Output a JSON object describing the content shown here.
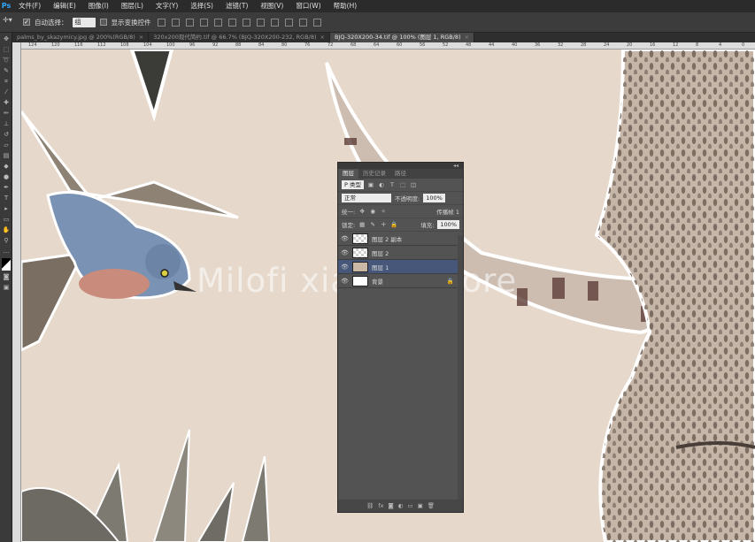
{
  "app": {
    "logo": "Ps"
  },
  "menu": [
    "文件(F)",
    "编辑(E)",
    "图像(I)",
    "图层(L)",
    "文字(Y)",
    "选择(S)",
    "滤镜(T)",
    "视图(V)",
    "窗口(W)",
    "帮助(H)"
  ],
  "options": {
    "tool_icon": "move-tool",
    "auto_select_label": "自动选择：",
    "auto_select_value": "组",
    "show_transform_label": "显示变换控件"
  },
  "tabs": [
    {
      "label": "palms_by_skazymicy.jpg @ 200%(RGB/8)",
      "close": "×",
      "active": false
    },
    {
      "label": "320x200现代简约.tif @ 66.7% (BJQ-320X200-232, RGB/8)",
      "close": "×",
      "active": false
    },
    {
      "label": "BJQ-320X200-34.tif @ 100% (图层 1, RGB/8)",
      "close": "×",
      "active": true
    }
  ],
  "ruler_ticks": [
    "124",
    "120",
    "116",
    "112",
    "108",
    "104",
    "100",
    "96",
    "92",
    "88",
    "84",
    "80",
    "76",
    "72",
    "68",
    "64",
    "60",
    "56",
    "52",
    "48",
    "44",
    "40",
    "36",
    "32",
    "28",
    "24",
    "20",
    "16",
    "12",
    "8",
    "4",
    "0"
  ],
  "watermark": "Milofi xiaoou Store",
  "layers_panel": {
    "collapse": "◂◂",
    "tabs": [
      "图层",
      "历史记录",
      "路径"
    ],
    "filter_label": "P 类型",
    "blend_mode": "正常",
    "opacity_label": "不透明度:",
    "opacity_value": "100%",
    "unify_label": "统一:",
    "propagate_label": "传播帧 1",
    "lock_label": "锁定:",
    "fill_label": "填充:",
    "fill_value": "100%",
    "layers": [
      {
        "name": "图层 2 副本",
        "visible": true,
        "thumb": "transparent",
        "selected": false
      },
      {
        "name": "图层 2",
        "visible": true,
        "thumb": "transparent",
        "selected": false
      },
      {
        "name": "图层 1",
        "visible": true,
        "thumb": "image",
        "selected": true
      },
      {
        "name": "背景",
        "visible": true,
        "thumb": "white",
        "selected": false,
        "locked": true
      }
    ],
    "footer_icons": [
      "link-icon",
      "fx-icon",
      "mask-icon",
      "adjustment-icon",
      "group-icon",
      "new-layer-icon",
      "trash-icon"
    ]
  },
  "colors": {
    "accent": "#46577a",
    "canvas_bg": "#e6d9cc",
    "bird_blue": "#7a92b3",
    "elephant": "#8a7d72"
  }
}
